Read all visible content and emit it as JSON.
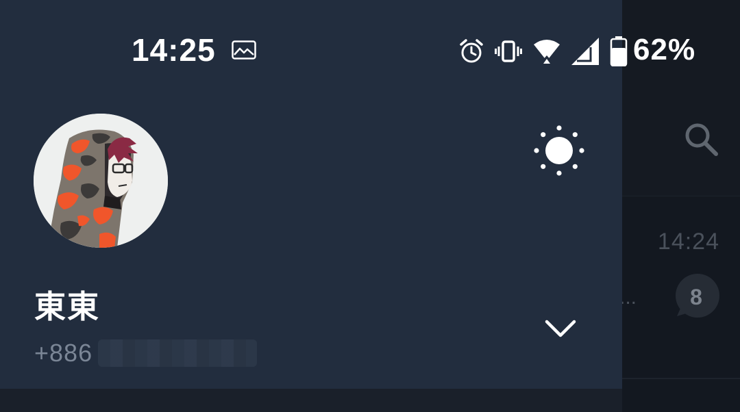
{
  "status_bar": {
    "time": "14:25",
    "battery_percent": "62%",
    "icons": [
      "gallery-icon",
      "alarm-icon",
      "vibrate-icon",
      "wifi-icon",
      "signal-icon",
      "battery-icon"
    ]
  },
  "drawer": {
    "profile": {
      "name": "東東",
      "phone_prefix": "+886",
      "avatar": "avatar"
    },
    "theme_toggle_icon": "sun-icon",
    "expand_icon": "chevron-down-icon"
  },
  "background_app": {
    "search_icon": "search-icon",
    "chat_time": "14:24",
    "unread_count": "8",
    "preview_ellipsis": "..."
  },
  "colors": {
    "drawer_bg": "#222d3e",
    "app_bg": "#131820",
    "text_primary": "#ffffff",
    "text_secondary": "#7b8696",
    "hood_orange": "#f0562b"
  }
}
